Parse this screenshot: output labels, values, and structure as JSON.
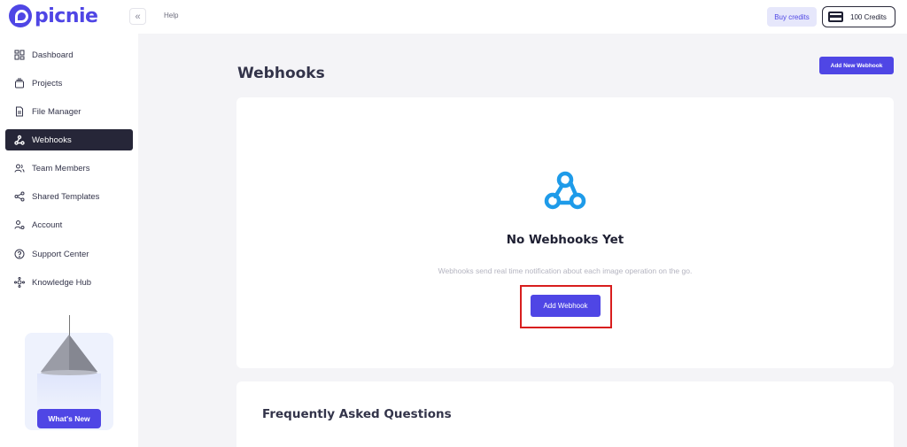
{
  "brand": {
    "name": "picnie",
    "color": "#4f46e5"
  },
  "header": {
    "collapse_icon": "double-chevron-left-icon",
    "help_label": "Help",
    "buy_credits_label": "Buy credits",
    "credits_label": "100 Credits",
    "credits_icon": "credit-card-icon"
  },
  "sidebar": {
    "items": [
      {
        "label": "Dashboard",
        "icon": "dashboard-icon",
        "active": false
      },
      {
        "label": "Projects",
        "icon": "projects-icon",
        "active": false
      },
      {
        "label": "File Manager",
        "icon": "file-icon",
        "active": false
      },
      {
        "label": "Webhooks",
        "icon": "webhook-icon",
        "active": true
      },
      {
        "label": "Team Members",
        "icon": "team-icon",
        "active": false
      },
      {
        "label": "Shared Templates",
        "icon": "share-icon",
        "active": false
      },
      {
        "label": "Account",
        "icon": "account-icon",
        "active": false
      },
      {
        "label": "Support Center",
        "icon": "help-circle-icon",
        "active": false
      },
      {
        "label": "Knowledge Hub",
        "icon": "knowledge-icon",
        "active": false
      }
    ],
    "promo": {
      "button_label": "What's New"
    }
  },
  "main": {
    "title": "Webhooks",
    "add_new_label": "Add New Webhook",
    "empty_state": {
      "title": "No Webhooks Yet",
      "description": "Webhooks send real time notification about each image operation on the go.",
      "button_label": "Add Webhook",
      "icon": "webhook-icon",
      "icon_color": "#1e9be9"
    },
    "faq_title": "Frequently Asked Questions"
  },
  "colors": {
    "accent": "#4f46e5",
    "active_nav": "#262638",
    "highlight": "#d81e1e"
  }
}
